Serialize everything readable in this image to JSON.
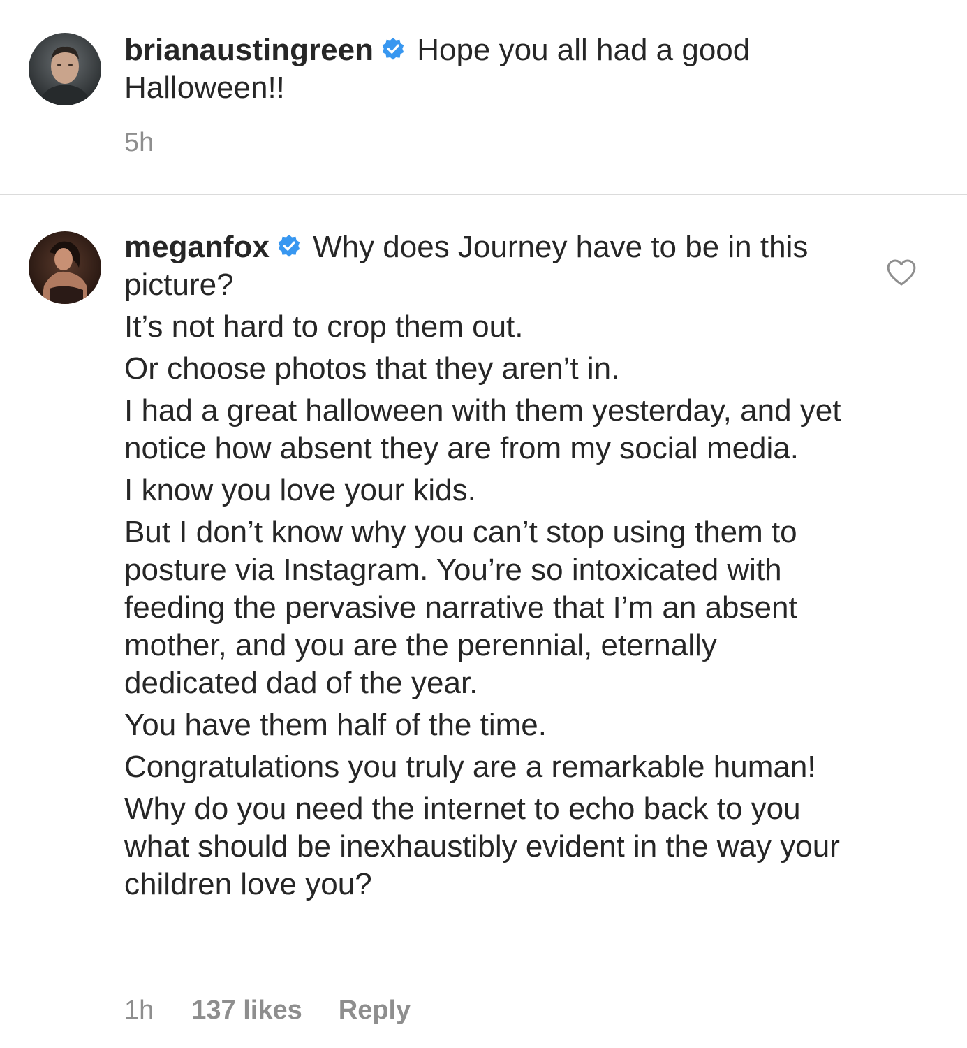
{
  "caption": {
    "username": "brianaustingreen",
    "verified_icon": "verified-badge-icon",
    "text": "Hope you all had a good Halloween!!",
    "timestamp": "5h"
  },
  "comment": {
    "username": "meganfox",
    "verified_icon": "verified-badge-icon",
    "lines": [
      "Why does Journey have to be in this picture?",
      "It’s not hard to crop them out.",
      "Or choose photos that they aren’t in.",
      "I had a great halloween with them yesterday, and yet notice how absent they are from my social media.",
      "I know you love your kids.",
      "But I don’t know why you can’t stop using them to posture via Instagram. You’re so intoxicated with feeding the pervasive narrative that I’m an absent mother, and you are the perennial, eternally dedicated dad of the year.",
      "You have them half of the time.",
      "Congratulations you truly are a remarkable human!",
      "Why do you need the internet to echo back to you what should be inexhaustibly evident in the way your children love you?"
    ],
    "timestamp": "1h",
    "likes": "137 likes",
    "reply_label": "Reply",
    "like_icon": "heart-outline-icon"
  },
  "colors": {
    "text": "#262626",
    "secondary": "#8e8e8e",
    "verified_blue": "#3897f0",
    "divider": "#dbdbdb"
  }
}
